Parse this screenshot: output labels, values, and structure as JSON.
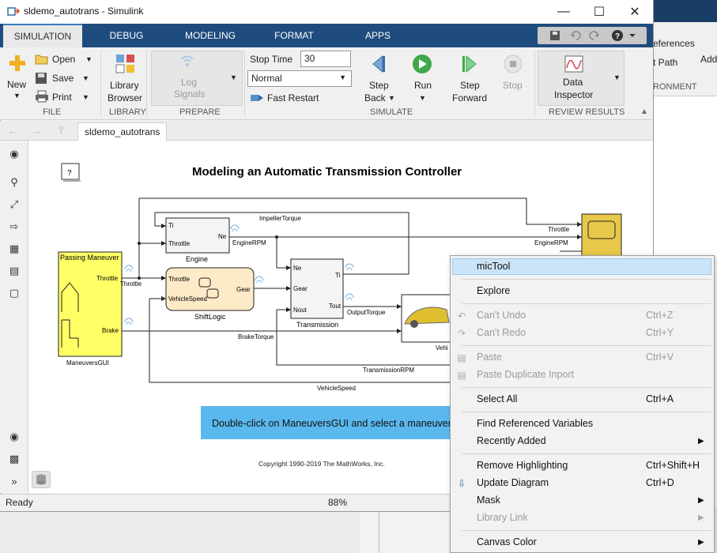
{
  "window": {
    "title": "sldemo_autotrans - Simulink"
  },
  "tabs": [
    "SIMULATION",
    "DEBUG",
    "MODELING",
    "FORMAT",
    "APPS"
  ],
  "ribbon": {
    "new_label": "New",
    "open_label": "Open",
    "save_label": "Save",
    "print_label": "Print",
    "file_section": "FILE",
    "library_browser_label_1": "Library",
    "library_browser_label_2": "Browser",
    "library_section": "LIBRARY",
    "log_signals_1": "Log",
    "log_signals_2": "Signals",
    "prepare_section": "PREPARE",
    "stop_time_label": "Stop Time",
    "stop_time_value": "30",
    "sim_mode": "Normal",
    "fast_restart": "Fast Restart",
    "step_back_1": "Step",
    "step_back_2": "Back",
    "run_label": "Run",
    "step_forward_1": "Step",
    "step_forward_2": "Forward",
    "stop_label": "Stop",
    "simulate_section": "SIMULATE",
    "data_inspector_1": "Data",
    "data_inspector_2": "Inspector",
    "review_section": "REVIEW RESULTS"
  },
  "background_window": {
    "references": "eferences",
    "path": "t Path",
    "add": "Add",
    "environment": "RONMENT"
  },
  "breadcrumb": {
    "model": "sldemo_autotrans"
  },
  "diagram": {
    "title": "Modeling an Automatic Transmission Controller",
    "help_block": "?",
    "passing_maneuver": "Passing Maneuver",
    "throttle_port": "Throttle",
    "brake_port": "Brake",
    "maneuvers_gui": "ManeuversGUI",
    "engine_ti": "Ti",
    "engine_throttle": "Throttle",
    "engine_ne": "Ne",
    "engine_label": "Engine",
    "engine_rpm": "EngineRPM",
    "impeller_torque": "ImpellerTorque",
    "shift_throttle": "Throttle",
    "shift_vehicle_speed": "VehicleSpeed",
    "shift_gear": "Gear",
    "shift_logic": "ShiftLogic",
    "trans_ne": "Ne",
    "trans_gear": "Gear",
    "trans_nout": "Nout",
    "trans_ti": "Ti",
    "trans_tout": "Tout",
    "transmission": "Transmission",
    "output_torque": "OutputTorque",
    "throttle_signal": "Throttle",
    "throttle_out": "Throttle",
    "engine_rpm_out": "EngineRPM",
    "vehicle_label": "Vehi",
    "brake_torque": "BrakeTorque",
    "transmission_rpm": "TransmissionRPM",
    "vehicle_speed": "VehicleSpeed",
    "info_banner": "Double-click on ManeuversGUI and select a maneuver",
    "copyright": "Copyright 1990-2019 The MathWorks, Inc."
  },
  "status": {
    "left": "Ready",
    "zoom": "88%"
  },
  "context_menu": {
    "items": [
      {
        "label": "micTool",
        "shortcut": ""
      },
      {
        "label": "Explore",
        "shortcut": ""
      },
      {
        "label": "Can't Undo",
        "shortcut": "Ctrl+Z"
      },
      {
        "label": "Can't Redo",
        "shortcut": "Ctrl+Y"
      },
      {
        "label": "Paste",
        "shortcut": "Ctrl+V"
      },
      {
        "label": "Paste Duplicate Inport",
        "shortcut": ""
      },
      {
        "label": "Select All",
        "shortcut": "Ctrl+A"
      },
      {
        "label": "Find Referenced Variables",
        "shortcut": ""
      },
      {
        "label": "Recently Added",
        "shortcut": ""
      },
      {
        "label": "Remove Highlighting",
        "shortcut": "Ctrl+Shift+H"
      },
      {
        "label": "Update Diagram",
        "shortcut": "Ctrl+D"
      },
      {
        "label": "Mask",
        "shortcut": ""
      },
      {
        "label": "Library Link",
        "shortcut": ""
      },
      {
        "label": "Canvas Color",
        "shortcut": ""
      }
    ]
  },
  "colors": {
    "tab_bar": "#1f4c7e",
    "block_yellow": "#ffff66",
    "scope_yellow": "#e8c84a",
    "banner_blue": "#5bb8ee",
    "menu_highlight": "#cce4f7"
  }
}
